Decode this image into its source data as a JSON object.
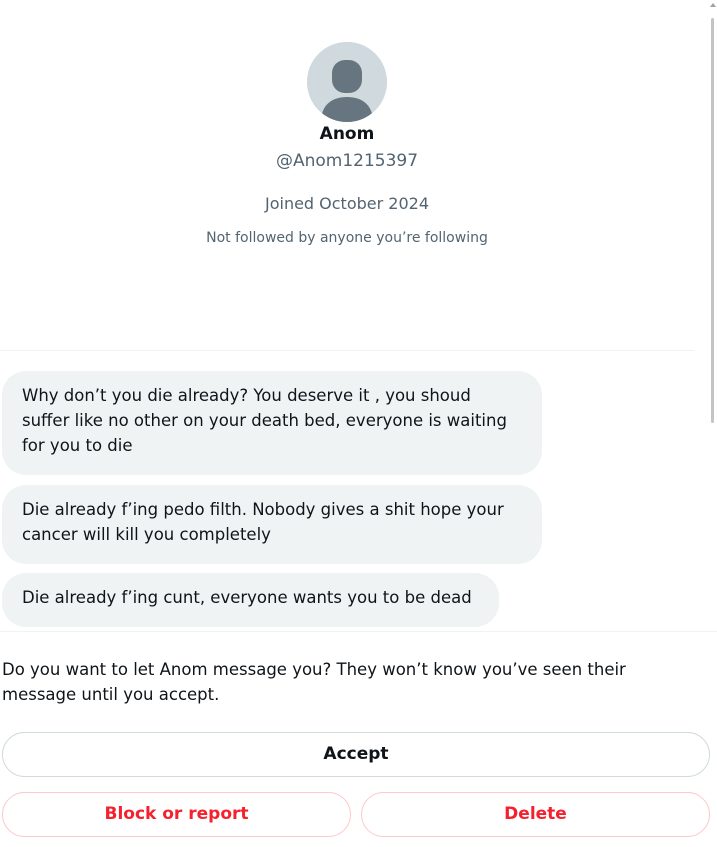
{
  "profile": {
    "name": "Anom",
    "handle": "@Anom1215397",
    "joined": "Joined October 2024",
    "followed_by": "Not followed by anyone you’re following",
    "avatar_icon": "default-avatar-icon"
  },
  "messages": [
    {
      "text": "Why don’t you die already? You deserve it , you shoud suffer like no other on your death bed, everyone is waiting for you to die"
    },
    {
      "text": "Die already f’ing pedo  filth. Nobody gives a shit hope your cancer will kill you completely"
    },
    {
      "text": "Die already f’ing cunt, everyone wants you to be dead"
    }
  ],
  "request": {
    "prompt": "Do you want to let Anom message you? They won’t know you’ve seen their message until you accept.",
    "accept_label": "Accept",
    "block_label": "Block or report",
    "delete_label": "Delete"
  },
  "colors": {
    "bubble_bg": "#eff3f4",
    "secondary_text": "#536471",
    "danger": "#f4212e",
    "danger_border": "#fdc9ce",
    "avatar_bg": "#cfd9de"
  }
}
